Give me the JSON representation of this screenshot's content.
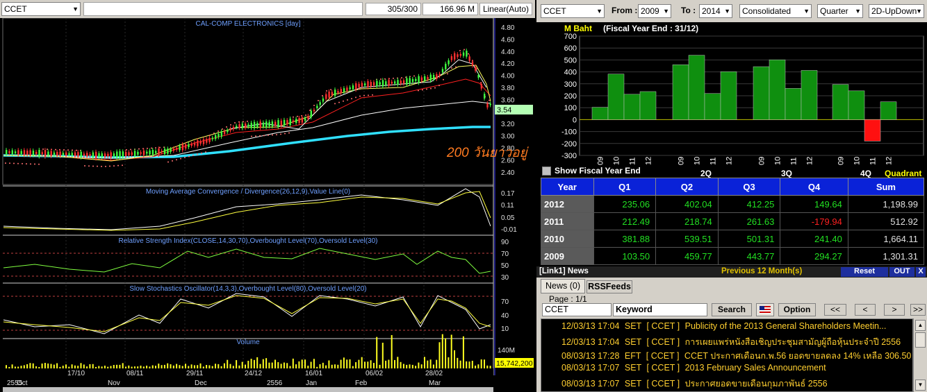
{
  "chart_panel": {
    "symbol": "CCET",
    "bars_count": "305/300",
    "volume_value": "166.96 M",
    "scale_mode": "Linear(Auto)",
    "price_title": "CAL-COMP ELECTRONICS [day]",
    "price_axis": [
      "4.80",
      "4.60",
      "4.40",
      "4.20",
      "4.00",
      "3.80",
      "3.60",
      "3.40",
      "3.20",
      "3.00",
      "2.80",
      "2.60",
      "2.40"
    ],
    "last_price": "3.54",
    "annotation": "200 วันยาวอยู่",
    "macd_title": "Moving Average Convergence / Divergence(26,12,9),Value Line(0)",
    "macd_axis": [
      "0.17",
      "0.11",
      "0.05",
      "-0.01"
    ],
    "rsi_title": "Relative Strength Index(CLOSE,14,30,70),Overbought Level(70),Oversold Level(30)",
    "rsi_axis": [
      "90",
      "70",
      "50",
      "30"
    ],
    "stoch_title": "Slow Stochastics Oscillator(14,3,3),Overbought Level(80),Oversold Level(20)",
    "stoch_axis": [
      "70",
      "40",
      "10"
    ],
    "volume_title": "Volume",
    "volume_axis_top": "140M",
    "volume_last": "15,742,200",
    "date_top": [
      "17/10",
      "08/11",
      "29/11",
      "24/12",
      "16/01",
      "06/02",
      "28/02"
    ],
    "date_bottom": [
      "2555",
      "Oct",
      "Nov",
      "Dec",
      "2556",
      "Jan",
      "Feb",
      "Mar"
    ]
  },
  "fundamental_panel": {
    "symbol": "CCET",
    "from_label": "From :",
    "from_value": "2009",
    "to_label": "To :",
    "to_value": "2014",
    "consolidation": "Consolidated",
    "period": "Quarter",
    "chart_style": "2D-UpDown",
    "unit_label": "M Baht",
    "fiscal_label": "(Fiscal Year End : 31/12)",
    "show_fy_label": "Show Fiscal Year End",
    "quadrant_label": "Quadrant",
    "quarter_labels": [
      "2Q",
      "3Q",
      "4Q"
    ],
    "year_ticks": [
      "09",
      "10",
      "11",
      "12"
    ],
    "y_axis": [
      "700",
      "600",
      "500",
      "400",
      "300",
      "200",
      "100",
      "0",
      "-100",
      "-200",
      "-300"
    ],
    "table_headers": [
      "Year",
      "Q1",
      "Q2",
      "Q3",
      "Q4",
      "Sum"
    ],
    "table_rows": [
      {
        "year": "2012",
        "q1": "235.06",
        "q2": "402.04",
        "q3": "412.25",
        "q4": "149.64",
        "sum": "1,198.99"
      },
      {
        "year": "2011",
        "q1": "212.49",
        "q2": "218.74",
        "q3": "261.63",
        "q4": "-179.94",
        "sum": "512.92"
      },
      {
        "year": "2010",
        "q1": "381.88",
        "q2": "539.51",
        "q3": "501.31",
        "q4": "241.40",
        "sum": "1,664.11"
      },
      {
        "year": "2009",
        "q1": "103.50",
        "q2": "459.77",
        "q3": "443.77",
        "q4": "294.27",
        "sum": "1,301.31"
      }
    ]
  },
  "chart_data": {
    "type": "bar",
    "title": "M Baht  (Fiscal Year End : 31/12)",
    "categories": [
      "Q1 2009",
      "Q1 2010",
      "Q1 2011",
      "Q1 2012",
      "Q2 2009",
      "Q2 2010",
      "Q2 2011",
      "Q2 2012",
      "Q3 2009",
      "Q3 2010",
      "Q3 2011",
      "Q3 2012",
      "Q4 2009",
      "Q4 2010",
      "Q4 2011",
      "Q4 2012"
    ],
    "values": [
      103.5,
      381.88,
      212.49,
      235.06,
      459.77,
      539.51,
      218.74,
      402.04,
      443.77,
      501.31,
      261.63,
      412.25,
      294.27,
      241.4,
      -179.94,
      149.64
    ],
    "ylim": [
      -300,
      700
    ],
    "colors": {
      "positive": "#0f8f0f",
      "negative": "#ff1010"
    }
  },
  "news_panel": {
    "header": "[Link1] News",
    "period_label": "Previous 12 Month(s)",
    "reset_label": "Reset",
    "out_label": "OUT",
    "close_label": "X",
    "tab_news": "News (0)",
    "tab_rss": "RSSFeeds",
    "page_label": "Page : 1/1",
    "symbol_value": "CCET",
    "keyword_value": "Keyword",
    "search_label": "Search",
    "option_label": "Option",
    "nav": [
      "<<",
      "<",
      ">",
      ">>"
    ],
    "items": [
      {
        "date": "12/03/13 17:04",
        "src": "SET",
        "sym": "[ CCET ]",
        "text": "Publicity of the 2013 General Shareholders  Meetin..."
      },
      {
        "date": "12/03/13 17:04",
        "src": "SET",
        "sym": "[ CCET ]",
        "text": "การเผยแพร่หนังสือเชิญประชุมสามัญผู้ถือหุ้นประจำปี 2556"
      },
      {
        "date": "08/03/13 17:28",
        "src": "EFT",
        "sym": "[ CCET ]",
        "text": "CCET ประกาศเดือนก.พ.56 ยอดขายลดลง 14% เหลือ 306.50 ..."
      },
      {
        "date": "08/03/13 17:07",
        "src": "SET",
        "sym": "[ CCET ]",
        "text": "2013 February Sales Announcement"
      },
      {
        "date": "08/03/13 17:07",
        "src": "SET",
        "sym": "[ CCET ]",
        "text": "ประกาศยอดขายเดือนกุมภาพันธ์ 2556"
      }
    ]
  }
}
